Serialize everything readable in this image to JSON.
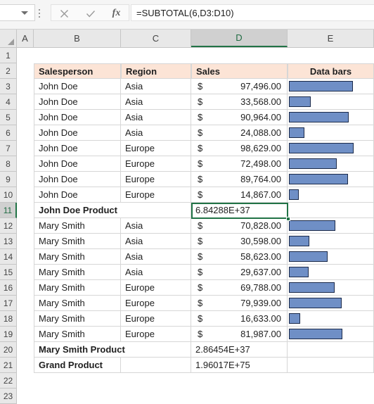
{
  "formula_bar": {
    "name_box_value": "",
    "cancel_icon": "close-icon",
    "enter_icon": "check-icon",
    "function_icon": "fx-icon",
    "formula": "=SUBTOTAL(6,D3:D10)"
  },
  "grid": {
    "column_headers": [
      "A",
      "B",
      "C",
      "D",
      "E"
    ],
    "selected_column": "D",
    "selected_row": "11",
    "selected_cell_ref": "D11",
    "row_numbers": [
      "1",
      "2",
      "3",
      "4",
      "5",
      "6",
      "7",
      "8",
      "9",
      "10",
      "11",
      "12",
      "13",
      "14",
      "15",
      "16",
      "17",
      "18",
      "19",
      "20",
      "21",
      "22",
      "23"
    ],
    "header_fill_color": "#fce4d6",
    "data_bar_color": "#6f8fc6",
    "data_bar_border_color": "#1b2a4a",
    "selection_color": "#217346"
  },
  "table": {
    "headers": {
      "salesperson": "Salesperson",
      "region": "Region",
      "sales": "Sales",
      "data_bars": "Data bars"
    },
    "currency_symbol": "$",
    "rows": [
      {
        "row": "3",
        "salesperson": "John Doe",
        "region": "Asia",
        "sales": "97,496.00",
        "value": 97496
      },
      {
        "row": "4",
        "salesperson": "John Doe",
        "region": "Asia",
        "sales": "33,568.00",
        "value": 33568
      },
      {
        "row": "5",
        "salesperson": "John Doe",
        "region": "Asia",
        "sales": "90,964.00",
        "value": 90964
      },
      {
        "row": "6",
        "salesperson": "John Doe",
        "region": "Asia",
        "sales": "24,088.00",
        "value": 24088
      },
      {
        "row": "7",
        "salesperson": "John Doe",
        "region": "Europe",
        "sales": "98,629.00",
        "value": 98629
      },
      {
        "row": "8",
        "salesperson": "John Doe",
        "region": "Europe",
        "sales": "72,498.00",
        "value": 72498
      },
      {
        "row": "9",
        "salesperson": "John Doe",
        "region": "Europe",
        "sales": "89,764.00",
        "value": 89764
      },
      {
        "row": "10",
        "salesperson": "John Doe",
        "region": "Europe",
        "sales": "14,867.00",
        "value": 14867
      },
      {
        "row": "12",
        "salesperson": "Mary Smith",
        "region": "Asia",
        "sales": "70,828.00",
        "value": 70828
      },
      {
        "row": "13",
        "salesperson": "Mary Smith",
        "region": "Asia",
        "sales": "30,598.00",
        "value": 30598
      },
      {
        "row": "14",
        "salesperson": "Mary Smith",
        "region": "Asia",
        "sales": "58,623.00",
        "value": 58623
      },
      {
        "row": "15",
        "salesperson": "Mary Smith",
        "region": "Asia",
        "sales": "29,637.00",
        "value": 29637
      },
      {
        "row": "16",
        "salesperson": "Mary Smith",
        "region": "Europe",
        "sales": "69,788.00",
        "value": 69788
      },
      {
        "row": "17",
        "salesperson": "Mary Smith",
        "region": "Europe",
        "sales": "79,939.00",
        "value": 79939
      },
      {
        "row": "18",
        "salesperson": "Mary Smith",
        "region": "Europe",
        "sales": "16,633.00",
        "value": 16633
      },
      {
        "row": "19",
        "salesperson": "Mary Smith",
        "region": "Europe",
        "sales": "81,987.00",
        "value": 81987
      }
    ],
    "subtotals": [
      {
        "row": "11",
        "label": "John Doe Product",
        "value": "6.84288E+37",
        "selected": true
      },
      {
        "row": "20",
        "label": "Mary Smith Product",
        "value": "2.86454E+37",
        "selected": false
      },
      {
        "row": "21",
        "label": "Grand Product",
        "value": "1.96017E+75",
        "selected": false
      }
    ]
  }
}
